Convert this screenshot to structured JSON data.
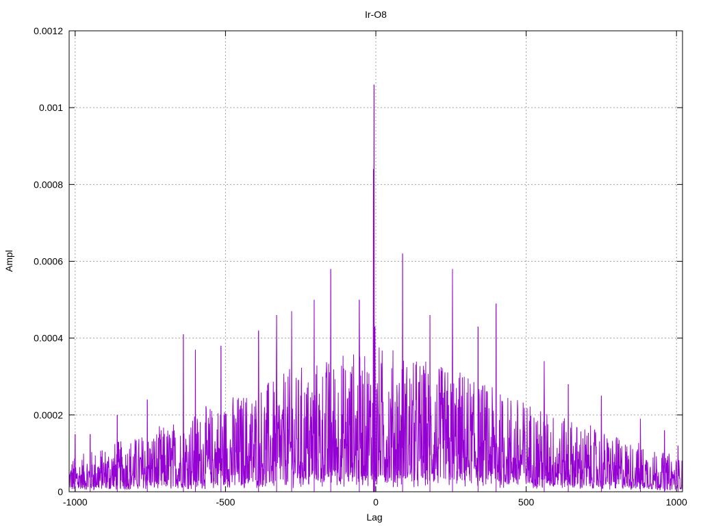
{
  "chart_data": {
    "type": "line",
    "title": "Ir-O8",
    "xlabel": "Lag",
    "ylabel": "Ampl",
    "xlim": [
      -1020,
      1020
    ],
    "ylim": [
      0,
      0.0012
    ],
    "grid": true,
    "x_ticks": [
      -1000,
      -500,
      0,
      500,
      1000
    ],
    "x_tick_labels": [
      "-1000",
      "-500",
      "0",
      "500",
      "1000"
    ],
    "y_ticks": [
      0,
      0.0002,
      0.0004,
      0.0006,
      0.0008,
      0.001,
      0.0012
    ],
    "y_tick_labels": [
      "0",
      "0.0002",
      "0.0004",
      "0.0006",
      "0.0008",
      "0.001",
      "0.0012"
    ],
    "series": [
      {
        "color": "#9400d3",
        "lag_range": [
          -1020,
          1020
        ],
        "amplitude_envelope": [
          [
            -1020,
            5e-05
          ],
          [
            -900,
            7e-05
          ],
          [
            -700,
            0.0001
          ],
          [
            -500,
            0.00014
          ],
          [
            -300,
            0.00018
          ],
          [
            -100,
            0.00021
          ],
          [
            0,
            0.00022
          ],
          [
            100,
            0.00021
          ],
          [
            300,
            0.00018
          ],
          [
            500,
            0.00014
          ],
          [
            700,
            0.0001
          ],
          [
            900,
            7e-05
          ],
          [
            1020,
            5e-05
          ]
        ],
        "peaks": [
          {
            "x": -6,
            "y": 0.00106
          },
          {
            "x": -8,
            "y": 0.00084
          },
          {
            "x": -3,
            "y": 0.00043
          },
          {
            "x": 89,
            "y": 0.00062
          },
          {
            "x": -150,
            "y": 0.00058
          },
          {
            "x": 255,
            "y": 0.00058
          },
          {
            "x": -205,
            "y": 0.0005
          },
          {
            "x": 400,
            "y": 0.00049
          },
          {
            "x": -55,
            "y": 0.0005
          },
          {
            "x": -330,
            "y": 0.00046
          },
          {
            "x": -280,
            "y": 0.00047
          },
          {
            "x": -390,
            "y": 0.00042
          },
          {
            "x": -640,
            "y": 0.00041
          },
          {
            "x": -515,
            "y": 0.00038
          },
          {
            "x": -600,
            "y": 0.00037
          },
          {
            "x": 180,
            "y": 0.00046
          },
          {
            "x": 340,
            "y": 0.00043
          },
          {
            "x": 560,
            "y": 0.00034
          },
          {
            "x": 640,
            "y": 0.00028
          },
          {
            "x": -760,
            "y": 0.00024
          },
          {
            "x": 750,
            "y": 0.00025
          },
          {
            "x": 880,
            "y": 0.00019
          },
          {
            "x": -860,
            "y": 0.0002
          },
          {
            "x": 960,
            "y": 0.00016
          },
          {
            "x": -950,
            "y": 0.00015
          },
          {
            "x": -1000,
            "y": 0.00015
          },
          {
            "x": 1005,
            "y": 0.00012
          }
        ]
      }
    ]
  }
}
